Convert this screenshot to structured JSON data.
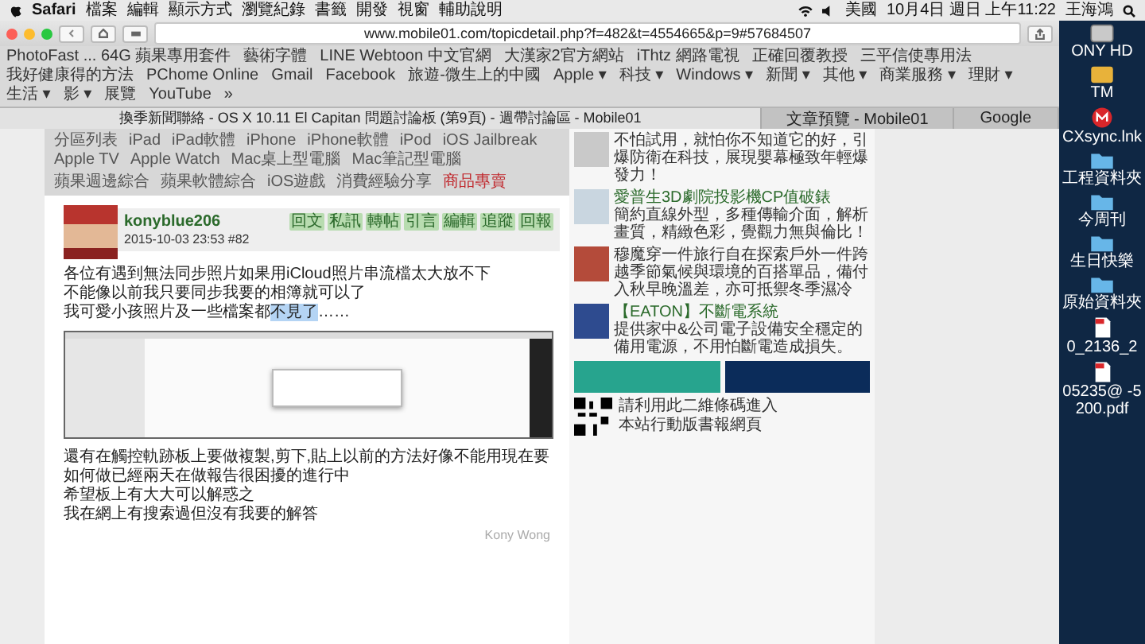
{
  "menu_bar": {
    "items": [
      "Safari",
      "檔案",
      "編輯",
      "顯示方式",
      "瀏覽紀錄",
      "書籤",
      "開發",
      "視窗",
      "輔助說明"
    ],
    "input_source": "美國",
    "clock": "10月4日 週日 上午11:22",
    "user": "王海鴻"
  },
  "toolbar": {
    "url": "www.mobile01.com/topicdetail.php?f=482&t=4554665&p=9#57684507"
  },
  "bookmarks": [
    "PhotoFast ... 64G 蘋果專用套件",
    "藝術字體",
    "LINE Webtoon 中文官網",
    "大漢家2官方網站",
    "iThtz 網路電視",
    "正確回覆教授",
    "三平信使專用法",
    "我好健康得的方法",
    "PChome Online",
    "Gmail",
    "Facebook",
    "旅遊-微生上的中國",
    "Apple ▾",
    "科技 ▾",
    "Windows ▾",
    "新聞 ▾",
    "其他 ▾",
    "商業服務 ▾",
    "理財 ▾",
    "生活 ▾",
    "影 ▾",
    "展覽",
    "YouTube",
    "»"
  ],
  "tabs": [
    {
      "label": "換季新聞聯絡 - OS X 10.11 El Capitan 問題討論板 (第9頁) - 週帶討論區 - Mobile01",
      "selected": true
    },
    {
      "label": "文章預覽 - Mobile01",
      "selected": false
    },
    {
      "label": "Google",
      "selected": false
    }
  ],
  "forum_nav": {
    "row_1": [
      {
        "label": "分區列表",
        "highlight": false
      },
      {
        "label": "iPad",
        "highlight": false
      },
      {
        "label": "iPad軟體",
        "highlight": false
      },
      {
        "label": "iPhone",
        "highlight": false
      },
      {
        "label": "iPhone軟體",
        "highlight": false
      },
      {
        "label": "iPod",
        "highlight": false
      },
      {
        "label": "iOS Jailbreak",
        "highlight": false
      },
      {
        "label": "Apple TV",
        "highlight": false
      },
      {
        "label": "Apple Watch",
        "highlight": false
      },
      {
        "label": "Mac桌上型電腦",
        "highlight": false
      },
      {
        "label": "Mac筆記型電腦",
        "highlight": false
      }
    ],
    "row_2": [
      {
        "label": "蘋果週邊綜合",
        "highlight": false
      },
      {
        "label": "蘋果軟體綜合",
        "highlight": false
      },
      {
        "label": "iOS遊戲",
        "highlight": false
      },
      {
        "label": "消費經驗分享",
        "highlight": false
      },
      {
        "label": "商品專賣",
        "highlight": true
      }
    ]
  },
  "post": {
    "author": "konyblue206",
    "meta": "2015-10-03 23:53 #82",
    "actions": [
      "回文",
      "私訊",
      "轉帖",
      "引言",
      "編輯",
      "追蹤",
      "回報"
    ],
    "lines": [
      {
        "text": "各位有遇到無法同步照片如果用iCloud照片串流檔太大放不下"
      },
      {
        "text": "不能像以前我只要同步我要的相簿就可以了"
      },
      {
        "text": "我可愛小孩照片及一些檔案都",
        "selection": "不見了",
        "rest": "……"
      }
    ],
    "after_lines": [
      "還有在觸控軌跡板上要做複製,剪下,貼上以前的方法好像不能用現在要如何做已經兩天在做報告很困擾的進行中",
      "希望板上有大大可以解惑之",
      "我在網上有搜索過但沒有我要的解答"
    ],
    "signature": "Kony Wong"
  },
  "sidebar": {
    "promos": [
      {
        "text": "不怕試用，就怕你不知道它的好，引爆防衛在科技，展現嬰幕極致年輕爆發力！"
      },
      {
        "title": "愛普生3D劇院投影機CP值破錶",
        "text": "簡約直線外型，多種傳輸介面，解析畫質，精緻色彩，覺觀力無與倫比！"
      },
      {
        "text": "穆魔穿一件旅行自在探索戶外一件跨越季節氣候與環境的百搭單品，備付入秋早晚溫差，亦可抵禦冬季濕冷"
      },
      {
        "title": "【EATON】不斷電系統",
        "text": "提供家中&公司電子設備安全穩定的備用電源，不用怕斷電造成損失。"
      }
    ],
    "qr_caption": [
      "請利用此二維條碼進入",
      "本站行動版書報網頁"
    ]
  },
  "desktop": [
    {
      "label": "ONY HD",
      "kind": "drive"
    },
    {
      "label": "TM",
      "kind": "backup"
    },
    {
      "label": "CXsync.lnk",
      "kind": "app"
    },
    {
      "label": "工程資料夾",
      "kind": "folder"
    },
    {
      "label": "今周刊",
      "kind": "folder"
    },
    {
      "label": "生日快樂",
      "kind": "folder"
    },
    {
      "label": "原始資料夾",
      "kind": "folder"
    },
    {
      "label": "0_2136_2",
      "kind": "pdf"
    },
    {
      "label": "05235@ -5200.pdf",
      "kind": "pdf"
    }
  ]
}
